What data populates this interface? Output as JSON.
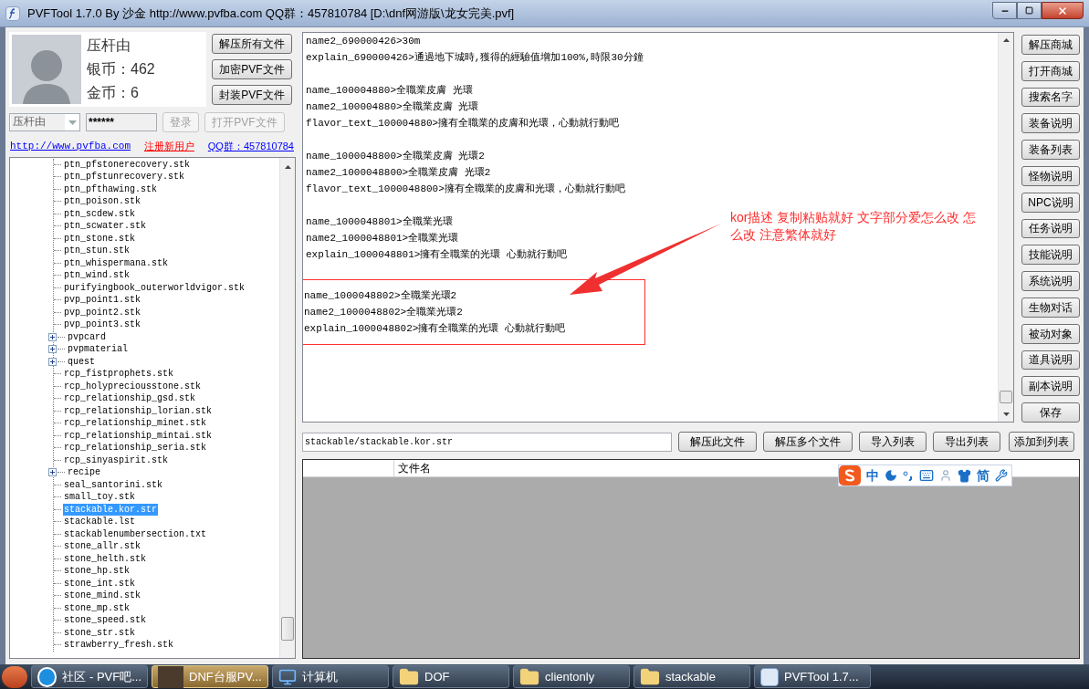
{
  "window": {
    "title": "PVFTool 1.7.0 By 沙金 http://www.pvfba.com QQ群：457810784 [D:\\dnf网游版\\龙女完美.pvf]"
  },
  "profile": {
    "name": "压杆由",
    "silver": "银币：462",
    "gold": "金币：6"
  },
  "profile_buttons": [
    {
      "label": "解压所有文件",
      "disabled": false
    },
    {
      "label": "加密PVF文件",
      "disabled": false
    },
    {
      "label": "封装PVF文件",
      "disabled": false
    }
  ],
  "login": {
    "account": "压杆由",
    "password": "******",
    "buttons": [
      {
        "label": "登录",
        "disabled": true
      },
      {
        "label": "打开PVF文件",
        "disabled": true
      }
    ]
  },
  "links": [
    {
      "label": "http://www.pvfba.com",
      "color": "#0000ff"
    },
    {
      "label": "注册新用户",
      "color": "#ff0000"
    },
    {
      "label": "QQ群：457810784",
      "color": "#0000ff"
    }
  ],
  "tree": {
    "items": [
      {
        "label": "ptn_pfstonerecovery.stk",
        "kind": "file",
        "selected": false
      },
      {
        "label": "ptn_pfstunrecovery.stk",
        "kind": "file",
        "selected": false
      },
      {
        "label": "ptn_pfthawing.stk",
        "kind": "file",
        "selected": false
      },
      {
        "label": "ptn_poison.stk",
        "kind": "file",
        "selected": false
      },
      {
        "label": "ptn_scdew.stk",
        "kind": "file",
        "selected": false
      },
      {
        "label": "ptn_scwater.stk",
        "kind": "file",
        "selected": false
      },
      {
        "label": "ptn_stone.stk",
        "kind": "file",
        "selected": false
      },
      {
        "label": "ptn_stun.stk",
        "kind": "file",
        "selected": false
      },
      {
        "label": "ptn_whispermana.stk",
        "kind": "file",
        "selected": false
      },
      {
        "label": "ptn_wind.stk",
        "kind": "file",
        "selected": false
      },
      {
        "label": "purifyingbook_outerworldvigor.stk",
        "kind": "file",
        "selected": false
      },
      {
        "label": "pvp_point1.stk",
        "kind": "file",
        "selected": false
      },
      {
        "label": "pvp_point2.stk",
        "kind": "file",
        "selected": false
      },
      {
        "label": "pvp_point3.stk",
        "kind": "file",
        "selected": false
      },
      {
        "label": "pvpcard",
        "kind": "folder",
        "expanded": false,
        "selected": false
      },
      {
        "label": "pvpmaterial",
        "kind": "folder",
        "expanded": false,
        "selected": false
      },
      {
        "label": "quest",
        "kind": "folder",
        "expanded": false,
        "selected": false
      },
      {
        "label": "rcp_fistprophets.stk",
        "kind": "file",
        "selected": false
      },
      {
        "label": "rcp_holypreciousstone.stk",
        "kind": "file",
        "selected": false
      },
      {
        "label": "rcp_relationship_gsd.stk",
        "kind": "file",
        "selected": false
      },
      {
        "label": "rcp_relationship_lorian.stk",
        "kind": "file",
        "selected": false
      },
      {
        "label": "rcp_relationship_minet.stk",
        "kind": "file",
        "selected": false
      },
      {
        "label": "rcp_relationship_mintai.stk",
        "kind": "file",
        "selected": false
      },
      {
        "label": "rcp_relationship_seria.stk",
        "kind": "file",
        "selected": false
      },
      {
        "label": "rcp_sinyaspirit.stk",
        "kind": "file",
        "selected": false
      },
      {
        "label": "recipe",
        "kind": "folder",
        "expanded": false,
        "selected": false
      },
      {
        "label": "seal_santorini.stk",
        "kind": "file",
        "selected": false
      },
      {
        "label": "small_toy.stk",
        "kind": "file",
        "selected": false
      },
      {
        "label": "stackable.kor.str",
        "kind": "file",
        "selected": true
      },
      {
        "label": "stackable.lst",
        "kind": "file",
        "selected": false
      },
      {
        "label": "stackablenumbersection.txt",
        "kind": "file",
        "selected": false
      },
      {
        "label": "stone_allr.stk",
        "kind": "file",
        "selected": false
      },
      {
        "label": "stone_helth.stk",
        "kind": "file",
        "selected": false
      },
      {
        "label": "stone_hp.stk",
        "kind": "file",
        "selected": false
      },
      {
        "label": "stone_int.stk",
        "kind": "file",
        "selected": false
      },
      {
        "label": "stone_mind.stk",
        "kind": "file",
        "selected": false
      },
      {
        "label": "stone_mp.stk",
        "kind": "file",
        "selected": false
      },
      {
        "label": "stone_speed.stk",
        "kind": "file",
        "selected": false
      },
      {
        "label": "stone_str.stk",
        "kind": "file",
        "selected": false
      },
      {
        "label": "strawberry_fresh.stk",
        "kind": "file",
        "selected": false
      }
    ]
  },
  "editor": {
    "blocks": [
      {
        "highlighted": false,
        "lines": [
          "name2_690000426>30m",
          "explain_690000426>通過地下城時,獲得的經驗值增加100%,時限30分鐘"
        ]
      },
      {
        "highlighted": false,
        "lines": [
          "name_100004880>全職業皮膚 光環",
          "name2_100004880>全職業皮膚 光環",
          "flavor_text_100004880>擁有全職業的皮膚和光環，心動就行動吧"
        ]
      },
      {
        "highlighted": false,
        "lines": [
          "name_1000048800>全職業皮膚 光環2",
          "name2_1000048800>全職業皮膚 光環2",
          "flavor_text_1000048800>擁有全職業的皮膚和光環，心動就行動吧"
        ]
      },
      {
        "highlighted": false,
        "lines": [
          "name_1000048801>全職業光環",
          "name2_1000048801>全職業光環",
          "explain_1000048801>擁有全職業的光環 心動就行動吧"
        ]
      },
      {
        "highlighted": true,
        "lines": [
          "name_1000048802>全職業光環2",
          "name2_1000048802>全職業光環2",
          "explain_1000048802>擁有全職業的光環 心動就行動吧"
        ]
      }
    ],
    "annotation": "kor描述 复制粘贴就好 文字部分爱怎么改 怎么改 注意繁体就好"
  },
  "side_buttons": [
    "解压商城",
    "打开商城",
    "搜索名字",
    "装备说明",
    "装备列表",
    "怪物说明",
    "NPC说明",
    "任务说明",
    "技能说明",
    "系统说明",
    "生物对话",
    "被动对象",
    "道具说明",
    "副本说明",
    "保存"
  ],
  "path_field": {
    "value": "stackable/stackable.kor.str"
  },
  "path_buttons": [
    "解压此文件",
    "解压多个文件",
    "导入列表",
    "导出列表",
    "添加到列表"
  ],
  "file_list": {
    "columns": [
      "文件名"
    ]
  },
  "ime_bar": {
    "mode": "中",
    "script": "简"
  },
  "taskbar": {
    "items": [
      {
        "label": "社区 - PVF吧...",
        "kind": "browser",
        "selected": false
      },
      {
        "label": "DNF台服PV...",
        "kind": "photo",
        "selected": true
      },
      {
        "label": "计算机",
        "kind": "computer",
        "selected": false
      },
      {
        "label": "DOF",
        "kind": "folder",
        "selected": false
      },
      {
        "label": "clientonly",
        "kind": "folder",
        "selected": false
      },
      {
        "label": "stackable",
        "kind": "folder",
        "selected": false
      },
      {
        "label": "PVFTool 1.7...",
        "kind": "app",
        "selected": false
      }
    ]
  }
}
